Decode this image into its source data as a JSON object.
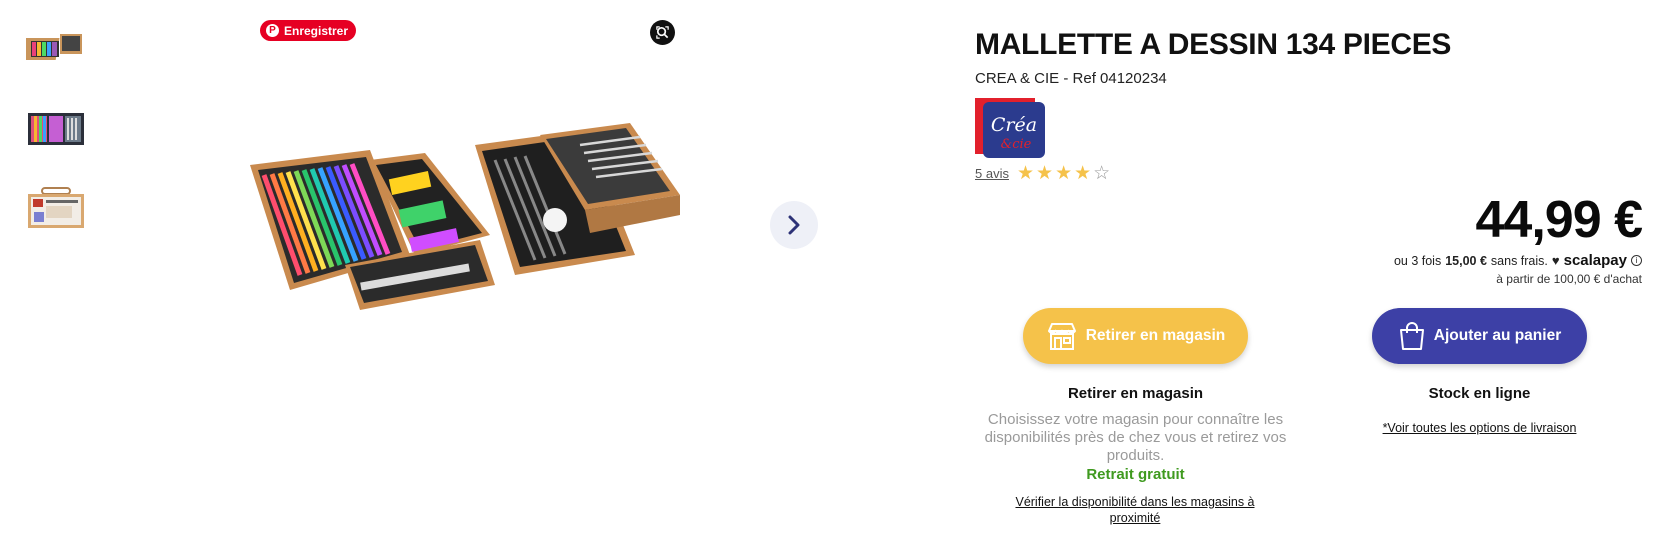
{
  "gallery": {
    "thumbnails": [
      {
        "name": "thumbnail-1"
      },
      {
        "name": "thumbnail-2"
      },
      {
        "name": "thumbnail-3"
      }
    ],
    "pinterest_label": "Enregistrer"
  },
  "product": {
    "title": "MALLETTE A DESSIN 134 PIECES",
    "subtitle": "CREA & CIE - Ref 04120234",
    "brand_logo_text_1": "Créa",
    "brand_logo_text_2": "&cie",
    "reviews_label": "5 avis",
    "rating": 4,
    "rating_max": 5
  },
  "pricing": {
    "price": "44,99 €",
    "installments_prefix": "ou 3 fois",
    "installments_amount": "15,00 €",
    "installments_suffix": "sans frais.",
    "installments_provider": "scalapay",
    "min_purchase": "à partir de 100,00 € d'achat"
  },
  "actions": {
    "store_button": "Retirer en magasin",
    "cart_button": "Ajouter au panier"
  },
  "store_pickup": {
    "title": "Retirer en magasin",
    "description": "Choisissez votre magasin pour connaître les disponibilités près de chez vous et retirez vos produits.",
    "free": "Retrait gratuit",
    "check_link": "Vérifier la disponibilité dans les magasins à proximité"
  },
  "online_stock": {
    "title": "Stock en ligne",
    "delivery_link": "*Voir toutes les options de livraison"
  },
  "colors": {
    "store_button": "#f5c24a",
    "cart_button": "#3d40a6",
    "free_pickup": "#3f9a1f",
    "pinterest": "#e60023"
  }
}
